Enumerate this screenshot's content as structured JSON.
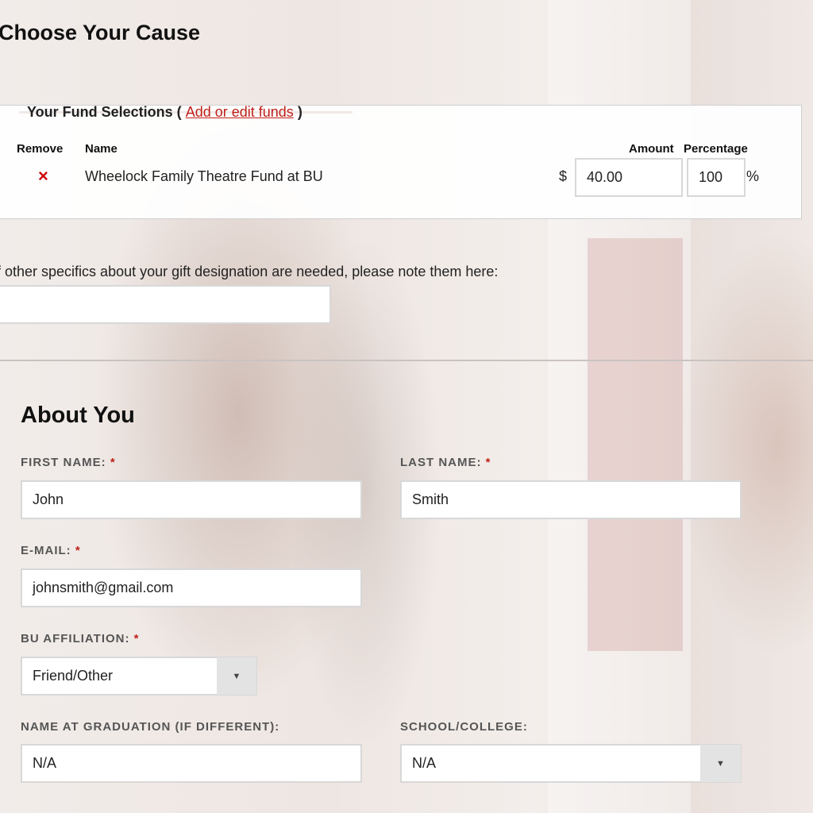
{
  "section1": {
    "title": "Choose Your Cause",
    "legend": "Your Fund Selections (",
    "legend_link": "Add or edit funds",
    "legend_close": ")",
    "columns": {
      "remove": "Remove",
      "name": "Name",
      "amount": "Amount",
      "percentage": "Percentage"
    },
    "fund": {
      "remove_icon": "×",
      "name": "Wheelock Family Theatre Fund at BU",
      "currency": "$",
      "amount": "40.00",
      "percentage": "100",
      "percent_sign": "%"
    },
    "note_label": "f other specifics about your gift designation are needed, please note them here:",
    "note_value": ""
  },
  "about": {
    "title": "About You",
    "required_mark": "*",
    "first_name_label": "FIRST NAME:",
    "first_name": "John",
    "last_name_label": "LAST NAME:",
    "last_name": "Smith",
    "email_label": "E-MAIL:",
    "email": "johnsmith@gmail.com",
    "affiliation_label": "BU AFFILIATION:",
    "affiliation": "Friend/Other",
    "grad_name_label": "NAME AT GRADUATION (IF DIFFERENT):",
    "grad_name": "N/A",
    "school_label": "SCHOOL/COLLEGE:",
    "school": "N/A"
  },
  "icons": {
    "remove": "close-icon",
    "dropdown": "chevron-down-icon"
  },
  "colors": {
    "accent": "#c0201a",
    "remove": "#cc0000"
  }
}
